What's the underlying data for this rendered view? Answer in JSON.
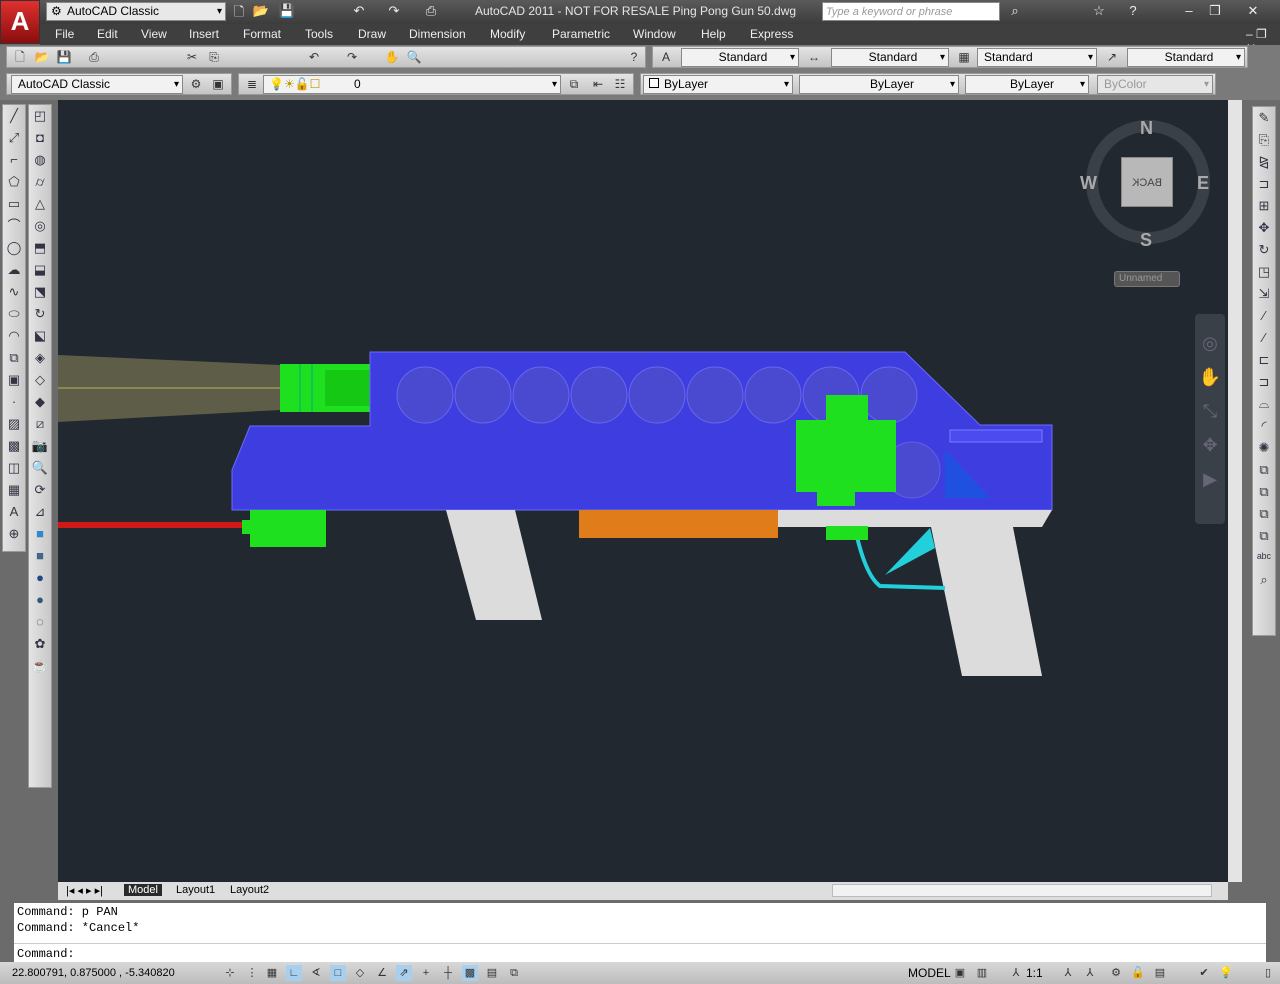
{
  "title_bar": {
    "workspace": "AutoCAD Classic",
    "title": "AutoCAD 2011 - NOT FOR RESALE    Ping Pong Gun 50.dwg",
    "search_placeholder": "Type a keyword or phrase",
    "logo": "A"
  },
  "menu": [
    "File",
    "Edit",
    "View",
    "Insert",
    "Format",
    "Tools",
    "Draw",
    "Dimension",
    "Modify",
    "Parametric",
    "Window",
    "Help",
    "Express"
  ],
  "styles": {
    "text_style": "Standard",
    "dim_style": "Standard",
    "table_style": "Standard",
    "mleader_style": "Standard"
  },
  "layers": {
    "workspace": "AutoCAD Classic",
    "current_layer": "0",
    "color": "ByLayer",
    "linetype": "ByLayer",
    "lineweight": "ByLayer",
    "plotstyle": "ByColor"
  },
  "viewcube": {
    "n": "N",
    "s": "S",
    "e": "E",
    "w": "W",
    "face": "BACK",
    "ucs": "Unnamed"
  },
  "tabs": [
    "Model",
    "Layout1",
    "Layout2"
  ],
  "command": {
    "history": [
      "Command: p PAN",
      "Command: *Cancel*"
    ],
    "prompt": "Command:"
  },
  "status": {
    "coords": "22.800791,  0.875000  , -5.340820",
    "model": "MODEL",
    "scale": "1:1"
  },
  "colors": {
    "canvas": "#212830",
    "body": "#3d3de0",
    "green": "#1ee01e",
    "orange": "#e07c1a",
    "cyan": "#22d0dc",
    "grip": "#dcdcdc"
  }
}
